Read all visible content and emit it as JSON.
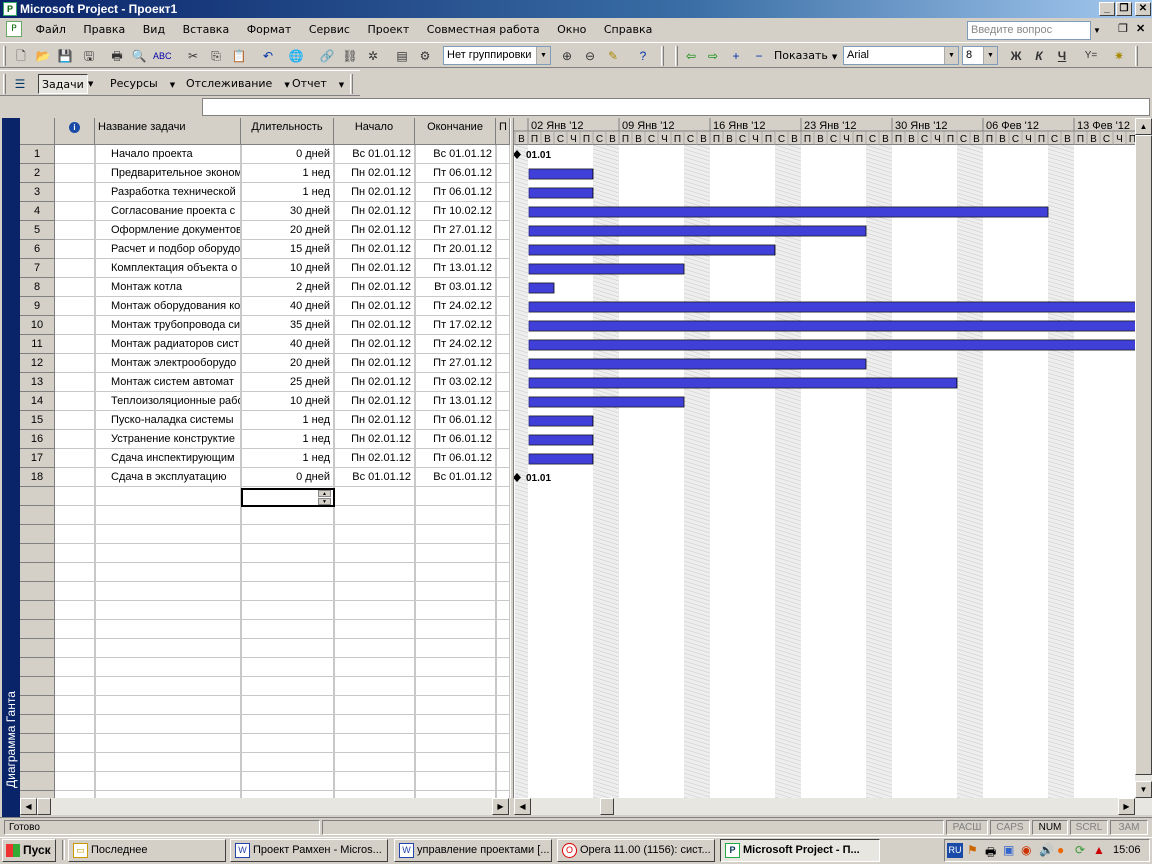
{
  "window": {
    "title": "Microsoft Project - Проект1"
  },
  "menu": {
    "items": [
      "Файл",
      "Правка",
      "Вид",
      "Вставка",
      "Формат",
      "Сервис",
      "Проект",
      "Совместная работа",
      "Окно",
      "Справка"
    ],
    "ask_placeholder": "Введите вопрос"
  },
  "toolbar1": {
    "grouping": "Нет группировки",
    "show_label": "Показать",
    "font": "Arial",
    "font_size": "8"
  },
  "toolbar2": {
    "tasks": "Задачи",
    "resources": "Ресурсы",
    "tracking": "Отслеживание",
    "report": "Отчет"
  },
  "view_bar": {
    "label": "Диаграмма Ганта"
  },
  "table": {
    "columns": [
      "Название задачи",
      "Длительность",
      "Начало",
      "Окончание",
      "П"
    ],
    "rows": [
      {
        "id": "1",
        "name": "Начало проекта",
        "duration": "0 дней",
        "start": "Вс 01.01.12",
        "finish": "Вс 01.01.12"
      },
      {
        "id": "2",
        "name": "Предварительное эконом",
        "duration": "1 нед",
        "start": "Пн 02.01.12",
        "finish": "Пт 06.01.12"
      },
      {
        "id": "3",
        "name": "Разработка технической",
        "duration": "1 нед",
        "start": "Пн 02.01.12",
        "finish": "Пт 06.01.12"
      },
      {
        "id": "4",
        "name": "Согласование проекта с",
        "duration": "30 дней",
        "start": "Пн 02.01.12",
        "finish": "Пт 10.02.12"
      },
      {
        "id": "5",
        "name": "Оформление документов",
        "duration": "20 дней",
        "start": "Пн 02.01.12",
        "finish": "Пт 27.01.12"
      },
      {
        "id": "6",
        "name": "Расчет и подбор оборудо",
        "duration": "15 дней",
        "start": "Пн 02.01.12",
        "finish": "Пт 20.01.12"
      },
      {
        "id": "7",
        "name": "Комплектация объекта о",
        "duration": "10 дней",
        "start": "Пн 02.01.12",
        "finish": "Пт 13.01.12"
      },
      {
        "id": "8",
        "name": "Монтаж котла",
        "duration": "2 дней",
        "start": "Пн 02.01.12",
        "finish": "Вт 03.01.12"
      },
      {
        "id": "9",
        "name": "Монтаж оборудования ко",
        "duration": "40 дней",
        "start": "Пн 02.01.12",
        "finish": "Пт 24.02.12"
      },
      {
        "id": "10",
        "name": "Монтаж трубопровода си",
        "duration": "35 дней",
        "start": "Пн 02.01.12",
        "finish": "Пт 17.02.12"
      },
      {
        "id": "11",
        "name": "Монтаж радиаторов сист",
        "duration": "40 дней",
        "start": "Пн 02.01.12",
        "finish": "Пт 24.02.12"
      },
      {
        "id": "12",
        "name": "Монтаж электрооборудо",
        "duration": "20 дней",
        "start": "Пн 02.01.12",
        "finish": "Пт 27.01.12"
      },
      {
        "id": "13",
        "name": "Монтаж систем автомат",
        "duration": "25 дней",
        "start": "Пн 02.01.12",
        "finish": "Пт 03.02.12"
      },
      {
        "id": "14",
        "name": "Теплоизоляционные рабо",
        "duration": "10 дней",
        "start": "Пн 02.01.12",
        "finish": "Пт 13.01.12"
      },
      {
        "id": "15",
        "name": "Пуско-наладка системы",
        "duration": "1 нед",
        "start": "Пн 02.01.12",
        "finish": "Пт 06.01.12"
      },
      {
        "id": "16",
        "name": "Устранение конструктие",
        "duration": "1 нед",
        "start": "Пн 02.01.12",
        "finish": "Пт 06.01.12"
      },
      {
        "id": "17",
        "name": "Сдача инспектирующим",
        "duration": "1 нед",
        "start": "Пн 02.01.12",
        "finish": "Пт 06.01.12"
      },
      {
        "id": "18",
        "name": "Сдача в эксплуатацию",
        "duration": "0 дней",
        "start": "Вс 01.01.12",
        "finish": "Вс 01.01.12"
      }
    ]
  },
  "gantt": {
    "weeks": [
      "02 Янв '12",
      "09 Янв '12",
      "16 Янв '12",
      "23 Янв '12",
      "30 Янв '12",
      "06 Фев '12",
      "13 Фев '12"
    ],
    "day_letters": [
      "П",
      "В",
      "С",
      "Ч",
      "П",
      "С",
      "В"
    ],
    "milestone_label": "01.01",
    "bar_color": "#3333cc"
  },
  "status": {
    "ready": "Готово",
    "indicators": [
      "РАСШ",
      "CAPS",
      "NUM",
      "SCRL",
      "ЗАМ"
    ]
  },
  "taskbar": {
    "start": "Пуск",
    "tasks": [
      "Последнее",
      "Проект Рамхен - Micros...",
      "управление проектами [...",
      "Opera 11.00 (1156): сист...",
      "Microsoft Project - П..."
    ],
    "clock": "15:06",
    "lang": "RU"
  }
}
